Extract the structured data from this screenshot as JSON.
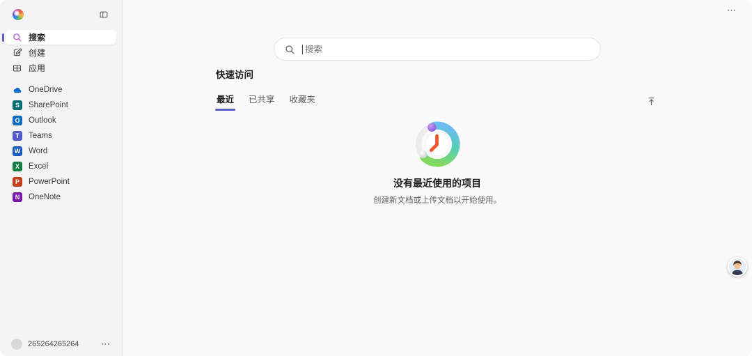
{
  "colors": {
    "accent": "#5b5fc7",
    "page_bg": "#fafafa",
    "sidebar_bg": "#f4f4f4"
  },
  "sidebar": {
    "logo_icon": "copilot-logo",
    "collapse_icon": "panel-toggle-icon",
    "nav": [
      {
        "id": "search",
        "label": "搜索",
        "icon": "search-icon",
        "active": true
      },
      {
        "id": "create",
        "label": "创建",
        "icon": "compose-icon",
        "active": false
      },
      {
        "id": "apps",
        "label": "应用",
        "icon": "apps-grid-icon",
        "active": false
      }
    ],
    "apps": [
      {
        "id": "onedrive",
        "label": "OneDrive",
        "icon": "onedrive-icon",
        "color": "#0a6cce"
      },
      {
        "id": "sharepoint",
        "label": "SharePoint",
        "icon": "sharepoint-icon",
        "color": "#036c70"
      },
      {
        "id": "outlook",
        "label": "Outlook",
        "icon": "outlook-icon",
        "color": "#0f6cbd"
      },
      {
        "id": "teams",
        "label": "Teams",
        "icon": "teams-icon",
        "color": "#5059c9"
      },
      {
        "id": "word",
        "label": "Word",
        "icon": "word-icon",
        "color": "#185abd"
      },
      {
        "id": "excel",
        "label": "Excel",
        "icon": "excel-icon",
        "color": "#107c41"
      },
      {
        "id": "powerpoint",
        "label": "PowerPoint",
        "icon": "powerpoint-icon",
        "color": "#c43e1c"
      },
      {
        "id": "onenote",
        "label": "OneNote",
        "icon": "onenote-icon",
        "color": "#7719aa"
      }
    ],
    "account": {
      "name": "265264265264",
      "more_icon": "more-horizontal-icon"
    }
  },
  "main": {
    "more_icon": "more-horizontal-icon",
    "search": {
      "placeholder": "搜索",
      "icon": "search-icon"
    },
    "quick_access": {
      "title": "快速访问",
      "tabs": [
        {
          "label": "最近",
          "active": true
        },
        {
          "label": "已共享",
          "active": false
        },
        {
          "label": "收藏夹",
          "active": false
        }
      ],
      "upload_icon": "arrow-upload-icon"
    },
    "empty_state": {
      "illustration": "clock-illustration",
      "title": "没有最近使用的项目",
      "subtitle": "创建新文档或上传文档以开始使用。"
    },
    "profile_avatar": "user-avatar"
  }
}
